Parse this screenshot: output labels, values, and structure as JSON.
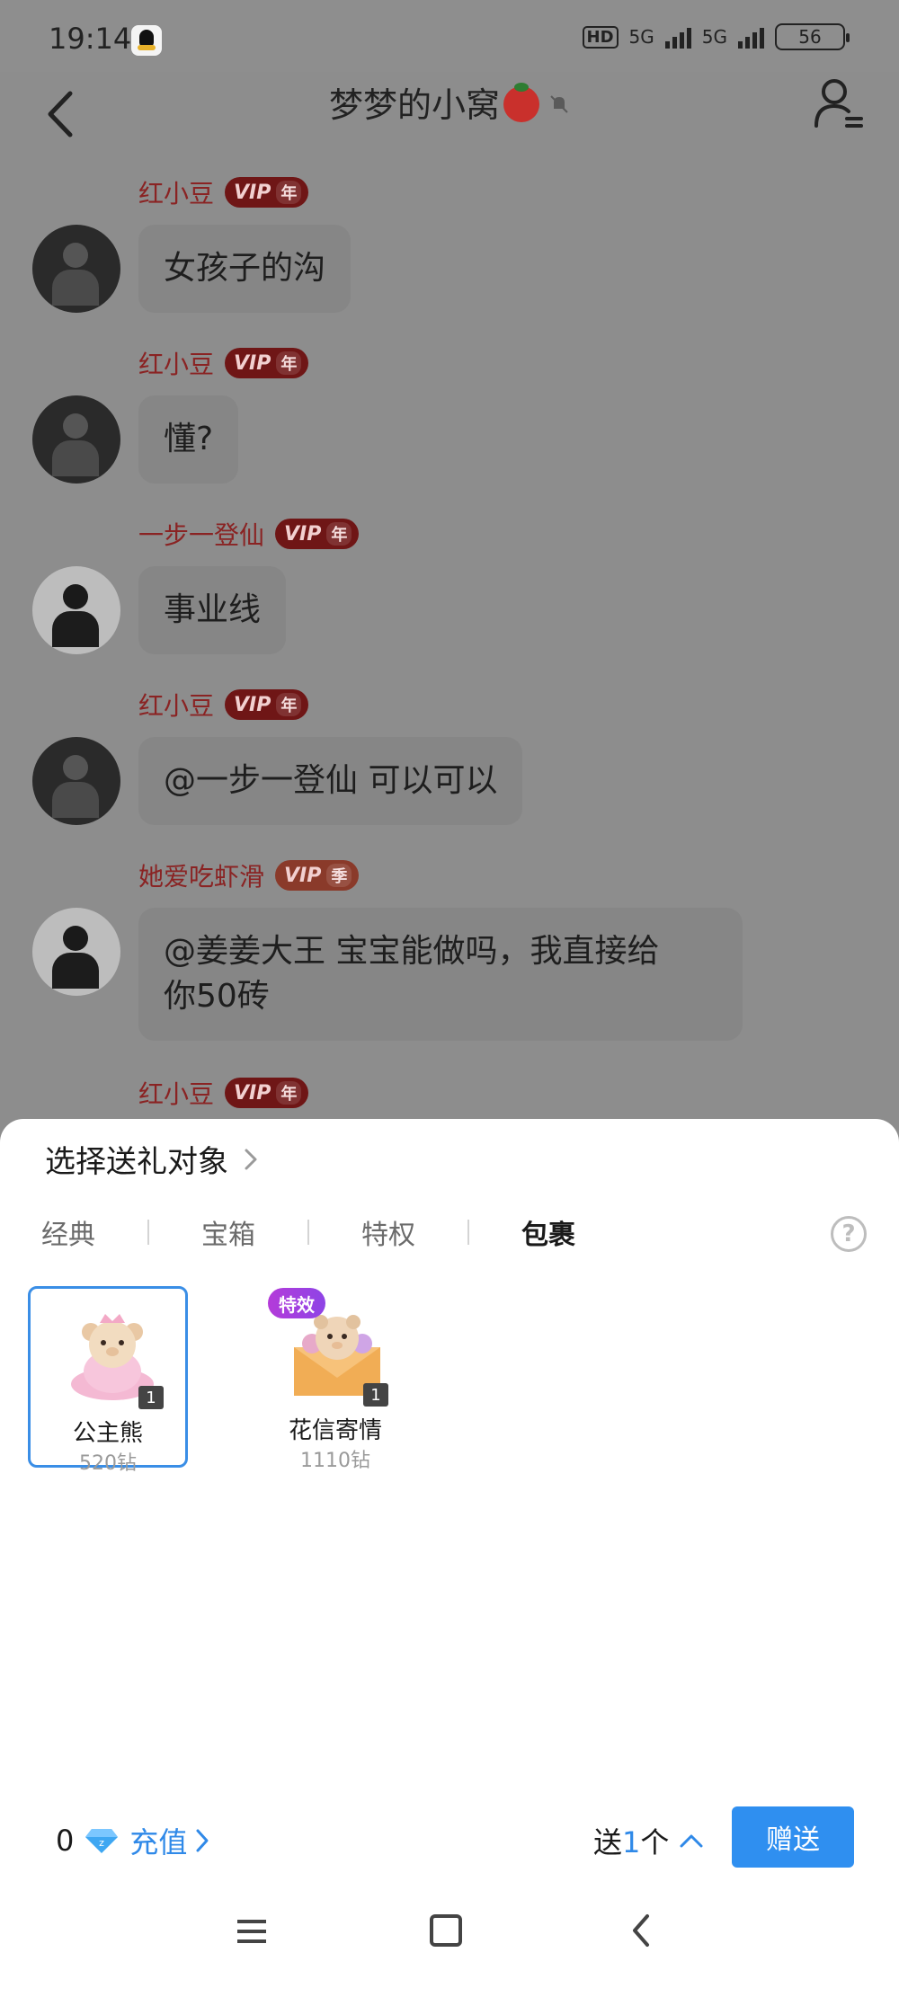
{
  "status_bar": {
    "time": "19:14",
    "hd": "HD",
    "net1": "5G",
    "net2": "5G",
    "battery": "56"
  },
  "header": {
    "title": "梦梦的小窝"
  },
  "messages": [
    {
      "nick": "红小豆",
      "vip": "VIP",
      "vip_tier": "年",
      "text": "女孩子的沟"
    },
    {
      "nick": "红小豆",
      "vip": "VIP",
      "vip_tier": "年",
      "text": "懂?"
    },
    {
      "nick": "一步一登仙",
      "vip": "VIP",
      "vip_tier": "年",
      "text": "事业线"
    },
    {
      "nick": "红小豆",
      "vip": "VIP",
      "vip_tier": "年",
      "text": "@一步一登仙 可以可以"
    },
    {
      "nick": "她爱吃虾滑",
      "vip": "VIP",
      "vip_tier": "季",
      "text_line1": "@姜姜大王 宝宝能做吗，我直接给",
      "text_line2": "你50砖"
    },
    {
      "nick": "红小豆",
      "vip": "VIP",
      "vip_tier": "年"
    }
  ],
  "gift_panel": {
    "recipient_label": "选择送礼对象",
    "tabs": [
      "经典",
      "宝箱",
      "特权",
      "包裹"
    ],
    "active_tab": "包裹",
    "help": "?",
    "gifts": [
      {
        "name": "公主熊",
        "price": "520钻",
        "count": "1",
        "selected": true
      },
      {
        "name": "花信寄情",
        "price": "1110钻",
        "count": "1",
        "badge": "特效"
      }
    ],
    "balance": "0",
    "recharge_label": "充值",
    "send_prefix": "送",
    "send_count": "1",
    "send_suffix": "个",
    "send_button": "赠送"
  },
  "colors": {
    "accent": "#2f8ff0",
    "selected_border": "#3a8ee6",
    "nick": "#8a2323",
    "vip_bg": "#6f1616",
    "badge": "#b43bd9"
  }
}
